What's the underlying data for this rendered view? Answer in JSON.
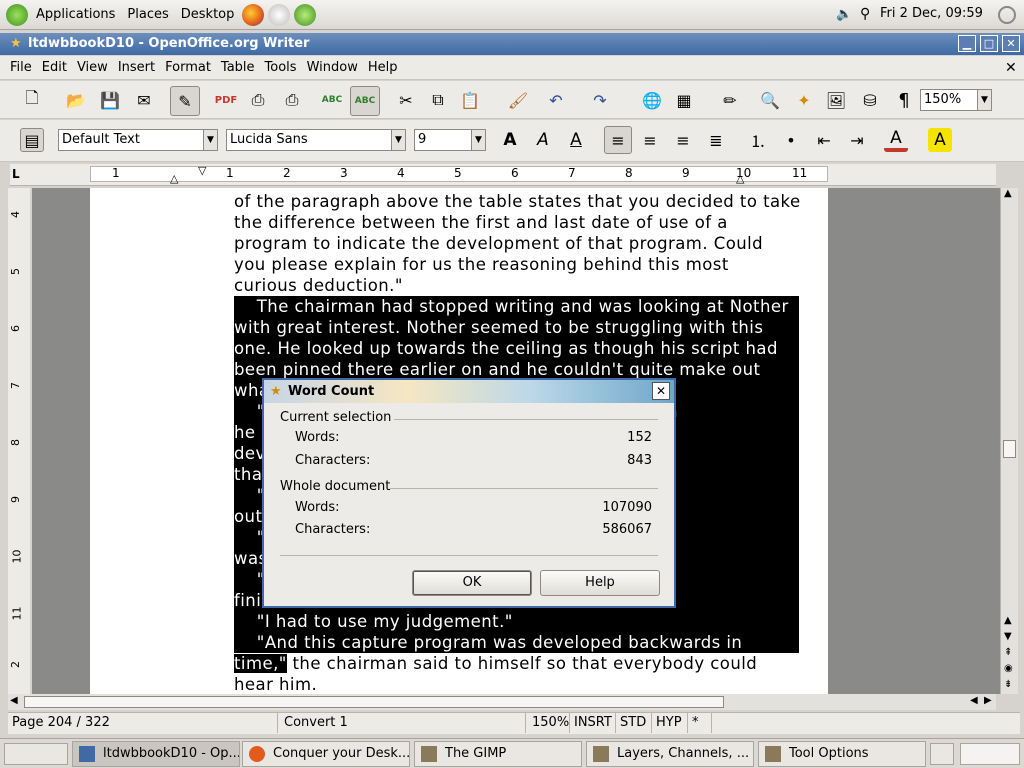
{
  "panel": {
    "menus": [
      "Applications",
      "Places",
      "Desktop"
    ],
    "clock": "Fri  2 Dec, 09:59"
  },
  "window": {
    "title": "ltdwbbookD10 - OpenOffice.org Writer"
  },
  "menubar": [
    "File",
    "Edit",
    "View",
    "Insert",
    "Format",
    "Table",
    "Tools",
    "Window",
    "Help"
  ],
  "toolbar": {
    "zoom": "150%"
  },
  "format": {
    "style": "Default Text",
    "font": "Lucida Sans",
    "size": "9"
  },
  "ruler": {
    "marks": [
      "1",
      "1",
      "2",
      "3",
      "4",
      "5",
      "6",
      "7",
      "8",
      "9",
      "10",
      "11"
    ],
    "vmarks": [
      "4",
      "5",
      "6",
      "7",
      "8",
      "9",
      "10",
      "11",
      "2"
    ]
  },
  "document": {
    "lines": [
      {
        "text": "of the paragraph above the table states that you decided to take",
        "sel": ""
      },
      {
        "text": "the difference between the first and last date of use of a",
        "sel": ""
      },
      {
        "text": "program to indicate the development of that program. Could",
        "sel": ""
      },
      {
        "text": "you please explain for us the reasoning behind this most",
        "sel": ""
      },
      {
        "text": "curious deduction.\"",
        "sel": ""
      },
      {
        "text": "",
        "sel": "    The chairman had stopped writing and was looking at Nother"
      },
      {
        "text": "",
        "sel": "with great interest. Nother seemed to be struggling with this"
      },
      {
        "text": "",
        "sel": "one. He looked up towards the ceiling as though his script had"
      },
      {
        "text": "",
        "sel": "been pinned there earlier on and he couldn't quite make out"
      },
      {
        "text": "",
        "sel": "what he w"
      },
      {
        "text": "",
        "sel": "    \"It was                                                      hough"
      },
      {
        "text": "",
        "sel": "he couldn                                                        "
      },
      {
        "text": "",
        "sel": "develop a                                                     use of"
      },
      {
        "text": "",
        "sel": "that progr                                                       "
      },
      {
        "text": "",
        "sel": "    \"So, Mr                                                  u find"
      },
      {
        "text": "",
        "sel": "out when                                                         "
      },
      {
        "text": "",
        "sel": "    \"You lo                                                 gram"
      },
      {
        "text": "",
        "sel": "was saved                                                        "
      },
      {
        "text": "",
        "sel": "    \"But su                                                 s"
      },
      {
        "text": "",
        "sel": "finished b                                                       "
      },
      {
        "text": "",
        "sel": "    \"I had to use my judgement.\"                                    "
      },
      {
        "text": "",
        "sel": "    \"And this capture program was developed backwards in   "
      },
      {
        "text": " the chairman said to himself so that everybody could",
        "sel": "time,\""
      },
      {
        "text": "hear him.",
        "sel": ""
      }
    ]
  },
  "status": {
    "page": "Page 204 / 322",
    "style": "Convert 1",
    "zoom": "150%",
    "insert": "INSRT",
    "selmode": "STD",
    "hyp": "HYP",
    "modified": "*"
  },
  "taskbar": [
    "ltdwbbookD10 - Op...",
    "Conquer your Desk...",
    "The GIMP",
    "Layers, Channels, ...",
    "Tool Options"
  ],
  "dialog": {
    "title": "Word Count",
    "current_label": "Current selection",
    "whole_label": "Whole document",
    "words_label": "Words:",
    "chars_label": "Characters:",
    "current_words": "152",
    "current_chars": "843",
    "whole_words": "107090",
    "whole_chars": "586067",
    "ok": "OK",
    "help": "Help"
  }
}
